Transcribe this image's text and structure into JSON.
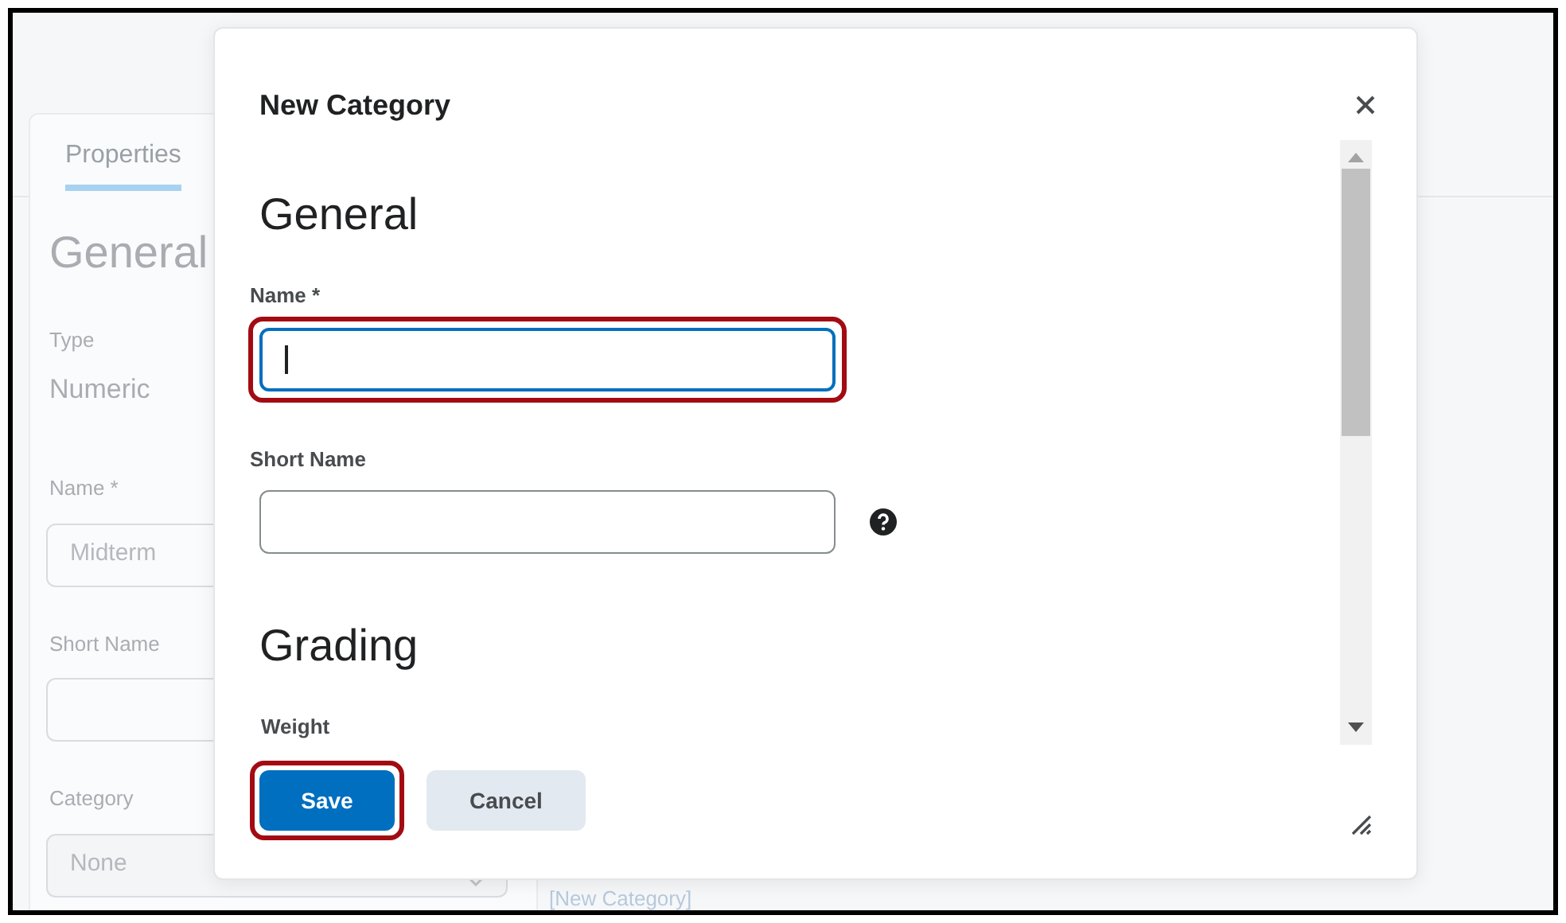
{
  "background_page": {
    "tabs": [
      {
        "label": "Properties",
        "selected": true
      }
    ],
    "heading": "General",
    "type": {
      "label": "Type",
      "value": "Numeric"
    },
    "fields": [
      {
        "label": "Name *",
        "value": "Midterm",
        "kind": "text"
      },
      {
        "label": "Short Name",
        "kind": "text"
      },
      {
        "label": "Category",
        "value": "None",
        "kind": "select"
      }
    ],
    "link": "[New Category]"
  },
  "dialog": {
    "title": "New Category",
    "sections": [
      {
        "heading": "General",
        "fields": [
          {
            "label": "Name *",
            "focused": true,
            "highlighted": true,
            "help": false
          },
          {
            "label": "Short Name",
            "focused": false,
            "highlighted": false,
            "help": true
          }
        ]
      },
      {
        "heading": "Grading",
        "fields": [
          {
            "label": "Weight",
            "kind": "label_only"
          }
        ]
      }
    ],
    "buttons": [
      {
        "label": "Save",
        "primary": true,
        "highlighted": true
      },
      {
        "label": "Cancel",
        "primary": false,
        "highlighted": false
      }
    ]
  }
}
